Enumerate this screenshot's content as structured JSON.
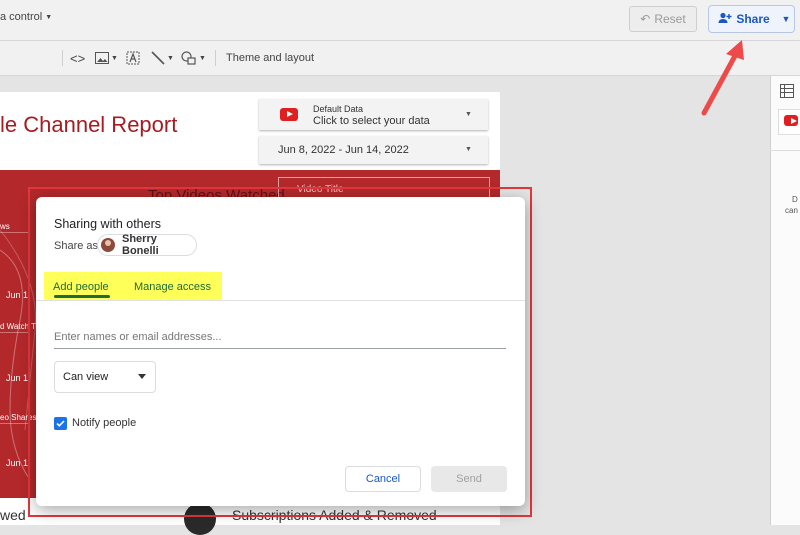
{
  "topbar": {
    "reset_label": "Reset",
    "share_label": "Share"
  },
  "toolbar": {
    "data_control_label": "a control",
    "theme_layout_label": "Theme and layout"
  },
  "report": {
    "title": "le Channel Report",
    "data_control": {
      "label": "Default Data",
      "value": "Click to select your data"
    },
    "date_range": "Jun 8, 2022 - Jun 14, 2022",
    "top_videos_label": "Top Videos Watched",
    "video_title_filter": "Video Title",
    "panel_labels": [
      "ws",
      "Jun 1",
      "d Watch Ti",
      "Jun 1",
      "eo Shares",
      "Jun 1"
    ],
    "bottom_left_text": "wed",
    "subscriptions_label": "Subscriptions Added & Removed"
  },
  "right_panel": {
    "text_line_1": "D",
    "text_line_2": "can"
  },
  "dialog": {
    "title": "Sharing with others",
    "share_as_label": "Share as",
    "user_name": "Sherry Bonelli",
    "tabs": [
      {
        "label": "Add people",
        "active": true
      },
      {
        "label": "Manage access",
        "active": false
      }
    ],
    "email_placeholder": "Enter names or email addresses...",
    "permission_value": "Can view",
    "notify_label": "Notify people",
    "notify_checked": true,
    "cancel_label": "Cancel",
    "send_label": "Send"
  },
  "colors": {
    "accent_blue": "#1a57c5",
    "report_red": "#b3282b",
    "highlight_yellow": "#ffff5a",
    "highlight_border": "#e0383b",
    "tab_green": "#1e6b36"
  }
}
